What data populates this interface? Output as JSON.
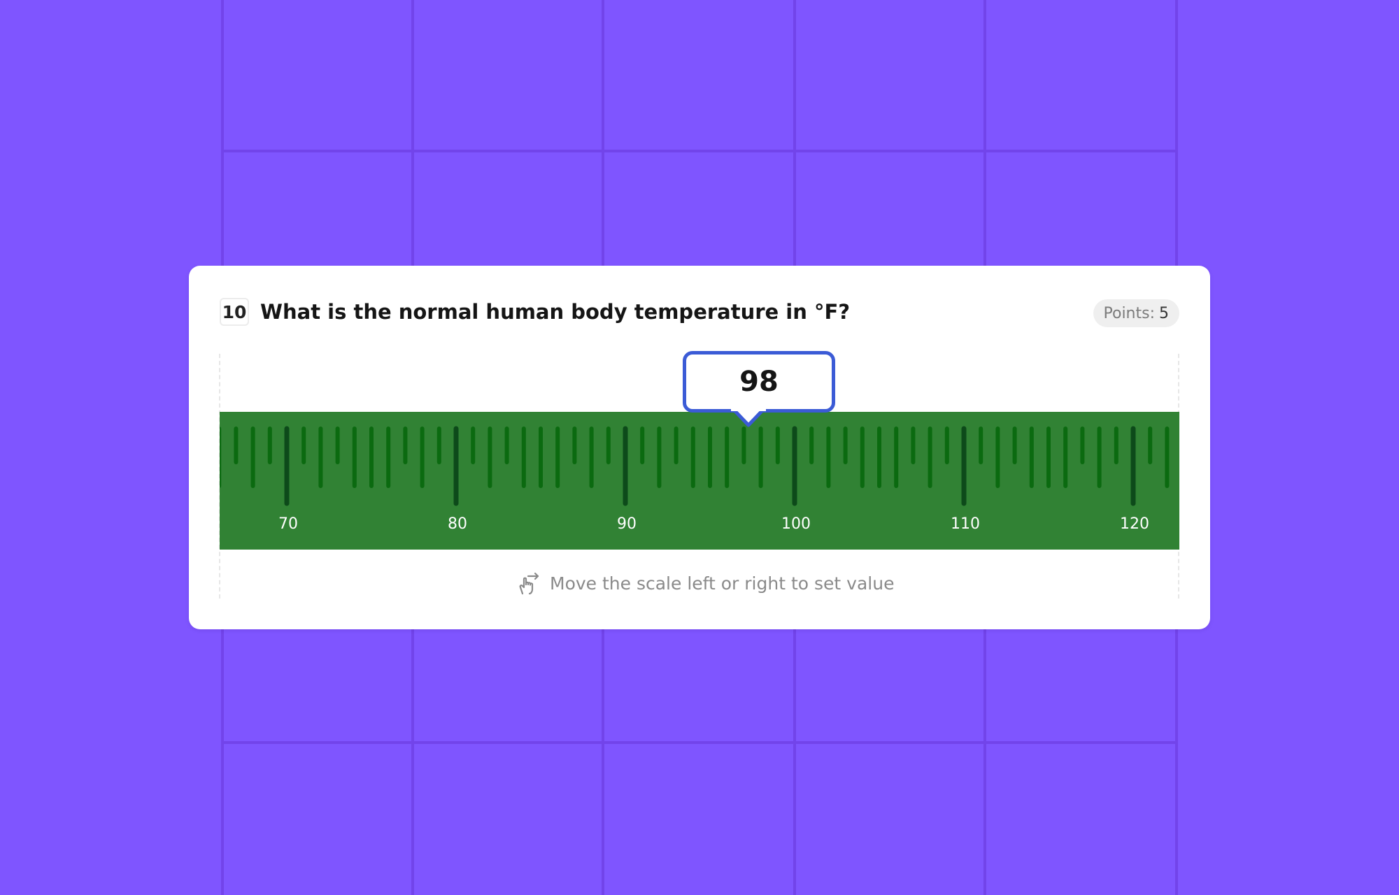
{
  "question": {
    "number": "10",
    "text": "What is the normal human body temperature in °F?"
  },
  "points": {
    "label": "Points:",
    "value": "5"
  },
  "scale": {
    "selected_value": "98",
    "tick_labels": [
      "70",
      "80",
      "90",
      "100",
      "110",
      "120"
    ],
    "min_visible": 66,
    "max_visible": 123,
    "minor_step": 1,
    "major_step": 5,
    "colors": {
      "background": "#318234",
      "minor_tick": "#0b6a10",
      "major_tick": "#0d4a1a",
      "bubble_border": "#3b5bd6"
    }
  },
  "hint": {
    "icon": "swipe-hand-icon",
    "text": "Move the scale left or right to set value"
  },
  "colors": {
    "page_background": "#7f55ff",
    "grid_lines": "#7244ea"
  }
}
